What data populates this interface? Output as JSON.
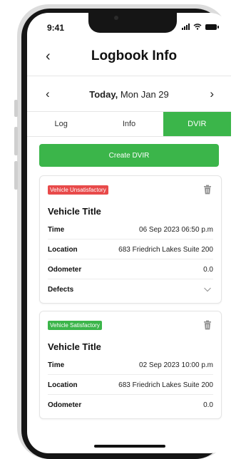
{
  "status_bar": {
    "time": "9:41"
  },
  "header": {
    "title": "Logbook Info",
    "back_icon": "‹"
  },
  "date_nav": {
    "today_label": "Today,",
    "date": " Mon Jan 29",
    "prev_icon": "‹",
    "next_icon": "›"
  },
  "tabs": [
    {
      "label": "Log",
      "active": false
    },
    {
      "label": "Info",
      "active": false
    },
    {
      "label": "DVIR",
      "active": true
    }
  ],
  "create_button": {
    "label": "Create DVIR"
  },
  "reports": [
    {
      "status": "Vehicle Unsatisfactory",
      "status_color": "#e84a4a",
      "title": "Vehicle Title",
      "rows": [
        {
          "label": "Time",
          "value": "06 Sep 2023 06:50 p.m"
        },
        {
          "label": "Location",
          "value": "683 Friedrich Lakes Suite 200"
        },
        {
          "label": "Odometer",
          "value": "0.0"
        },
        {
          "label": "Defects",
          "value": ""
        }
      ]
    },
    {
      "status": "Vehicle Satisfactory",
      "status_color": "#3bb54a",
      "title": "Vehicle Title",
      "rows": [
        {
          "label": "Time",
          "value": "02 Sep 2023 10:00 p.m"
        },
        {
          "label": "Location",
          "value": "683 Friedrich Lakes Suite 200"
        },
        {
          "label": "Odometer",
          "value": "0.0"
        }
      ]
    }
  ],
  "colors": {
    "accent": "#3bb54a",
    "danger": "#e84a4a"
  }
}
